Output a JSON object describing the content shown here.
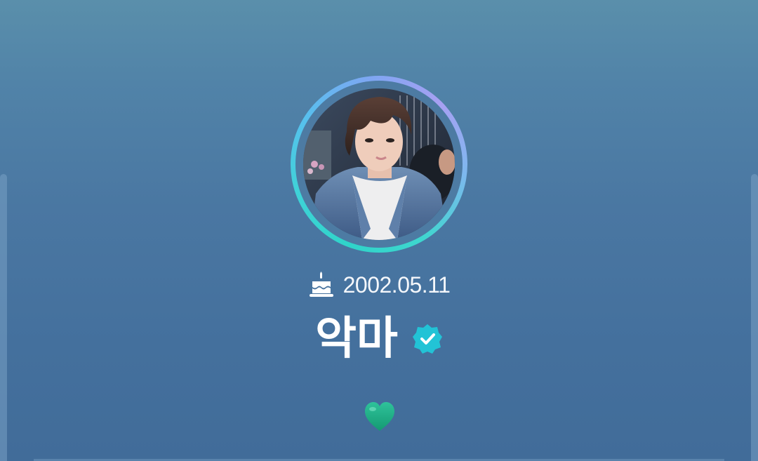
{
  "profile": {
    "birthday": "2002.05.11",
    "name": "악마",
    "verified": true
  },
  "icons": {
    "birthday": "birthday-cake-icon",
    "verified": "verified-badge-icon",
    "heart": "green-heart-icon"
  },
  "colors": {
    "background_top": "#5a8fab",
    "background_bottom": "#416c99",
    "ring_start": "#2fd4c9",
    "ring_end": "#a7a0f2",
    "verified_badge": "#22c3d6",
    "heart": "#1fb58f"
  }
}
